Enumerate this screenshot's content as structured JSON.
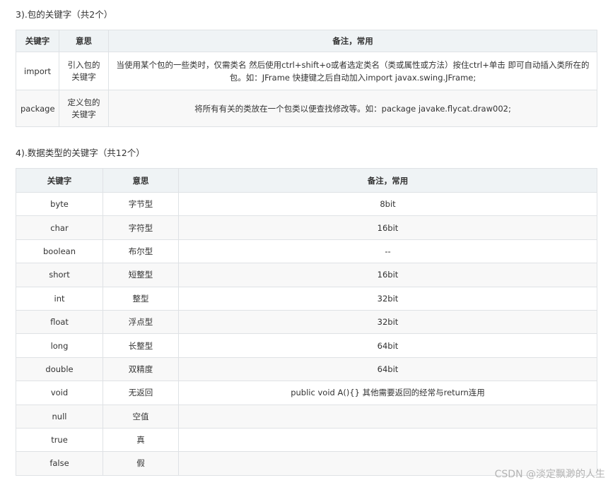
{
  "section3": {
    "heading": "3).包的关键字（共2个）",
    "headers": [
      "关键字",
      "意思",
      "备注，常用"
    ],
    "rows": [
      {
        "keyword": "import",
        "meaning": "引入包的关键字",
        "note": "当使用某个包的一些类时，仅需类名 然后使用ctrl+shift+o或者选定类名（类或属性或方法）按住ctrl+单击 即可自动插入类所在的包。如：JFrame 快捷键之后自动加入import javax.swing.JFrame;"
      },
      {
        "keyword": "package",
        "meaning": "定义包的关键字",
        "note": "将所有有关的类放在一个包类以便查找修改等。如：package javake.flycat.draw002;"
      }
    ]
  },
  "section4": {
    "heading": "4).数据类型的关键字（共12个）",
    "headers": [
      "关键字",
      "意思",
      "备注，常用"
    ],
    "rows": [
      {
        "keyword": "byte",
        "meaning": "字节型",
        "note": "8bit"
      },
      {
        "keyword": "char",
        "meaning": "字符型",
        "note": "16bit"
      },
      {
        "keyword": "boolean",
        "meaning": "布尔型",
        "note": "--"
      },
      {
        "keyword": "short",
        "meaning": "短整型",
        "note": "16bit"
      },
      {
        "keyword": "int",
        "meaning": "整型",
        "note": "32bit"
      },
      {
        "keyword": "float",
        "meaning": "浮点型",
        "note": "32bit"
      },
      {
        "keyword": "long",
        "meaning": "长整型",
        "note": "64bit"
      },
      {
        "keyword": "double",
        "meaning": "双精度",
        "note": "64bit"
      },
      {
        "keyword": "void",
        "meaning": "无返回",
        "note": "public void A(){} 其他需要返回的经常与return连用"
      },
      {
        "keyword": "null",
        "meaning": "空值",
        "note": ""
      },
      {
        "keyword": "true",
        "meaning": "真",
        "note": ""
      },
      {
        "keyword": "false",
        "meaning": "假",
        "note": ""
      }
    ]
  },
  "watermark": "CSDN @淡定飘渺的人生"
}
